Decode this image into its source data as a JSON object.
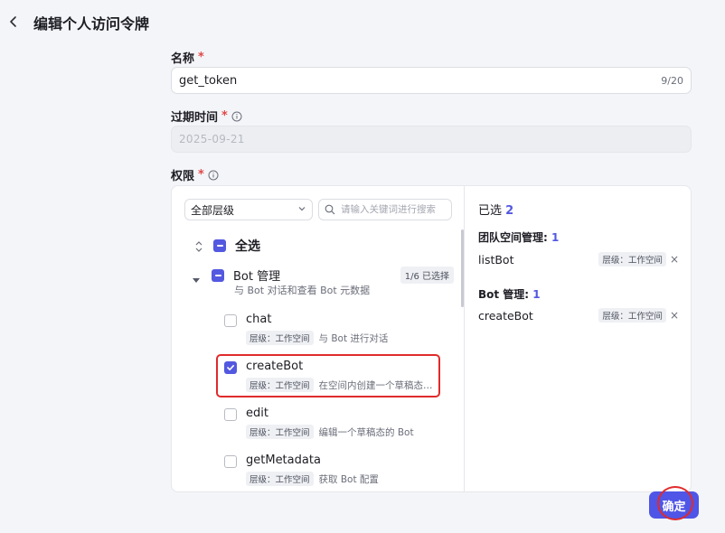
{
  "header": {
    "title": "编辑个人访问令牌"
  },
  "form": {
    "name": {
      "label": "名称",
      "required": "*",
      "value": "get_token",
      "count": "9/20"
    },
    "expiry": {
      "label": "过期时间",
      "required": "*",
      "value": "2025-09-21"
    },
    "permissions": {
      "label": "权限",
      "required": "*"
    }
  },
  "perm_panel": {
    "level_select": {
      "value": "全部层级",
      "options": [
        "全部层级"
      ]
    },
    "search": {
      "placeholder": "请输入关键词进行搜索"
    },
    "select_all": {
      "label": "全选",
      "state": "indeterminate"
    },
    "group": {
      "title": "Bot 管理",
      "badge": "1/6 已选择",
      "description": "与 Bot 对话和查看 Bot 元数据",
      "state": "indeterminate"
    },
    "items": [
      {
        "name": "chat",
        "tag": "层级：工作空间",
        "desc": "与 Bot 进行对话",
        "checked": false
      },
      {
        "name": "createBot",
        "tag": "层级：工作空间",
        "desc": "在空间内创建一个草稿态…",
        "checked": true
      },
      {
        "name": "edit",
        "tag": "层级：工作空间",
        "desc": "编辑一个草稿态的 Bot",
        "checked": false
      },
      {
        "name": "getMetadata",
        "tag": "层级：工作空间",
        "desc": "获取 Bot 配置",
        "checked": false
      }
    ]
  },
  "selected_panel": {
    "title": "已选",
    "count": "2",
    "groups": [
      {
        "title": "团队空间管理:",
        "count": "1",
        "item": {
          "name": "listBot",
          "tag": "层级：工作空间"
        }
      },
      {
        "title": "Bot 管理:",
        "count": "1",
        "item": {
          "name": "createBot",
          "tag": "层级：工作空间"
        }
      }
    ],
    "remove_glyph": "×"
  },
  "footer": {
    "confirm_label": "确定"
  },
  "colors": {
    "accent": "#5358e0",
    "required": "#e04848",
    "highlight": "#e02b2b"
  }
}
